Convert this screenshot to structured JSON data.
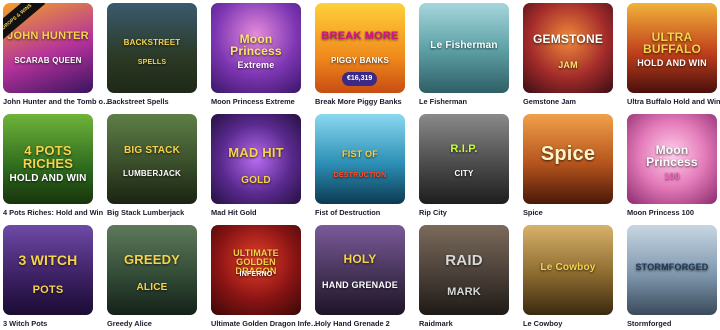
{
  "games": [
    {
      "name": "John Hunter and the Tomb of the Scarab Queen",
      "logo": "JOHN HUNTER",
      "sublogo": "SCARAB QUEEN",
      "badge": "DROPS & WINS",
      "bg": "#6a2f7d"
    },
    {
      "name": "Backstreet Spells",
      "logo": "BACKSTREET",
      "sublogo": "SPELLS",
      "bg": "#2b3a25"
    },
    {
      "name": "Moon Princess Extreme",
      "logo": "Moon Princess",
      "sublogo": "Extreme",
      "bg": "#6b2fa0"
    },
    {
      "name": "Break More Piggy Banks",
      "logo": "BREAK MORE",
      "sublogo": "PIGGY BANKS",
      "jackpot": "€16,319",
      "bg": "#f0c31c"
    },
    {
      "name": "Le Fisherman",
      "logo": "Le Fisherman",
      "bg": "#5fa3a7"
    },
    {
      "name": "Gemstone Jam",
      "logo": "GEMSTONE",
      "sublogo": "JAM",
      "bg": "#7a2323"
    },
    {
      "name": "Ultra Buffalo Hold and Win",
      "logo": "ULTRA BUFFALO",
      "sublogo": "HOLD AND WIN",
      "bg": "#7d1f1a"
    },
    {
      "name": "4 Pots Riches: Hold and Win",
      "logo": "4 POTS RICHES",
      "sublogo": "HOLD AND WIN",
      "bg": "#2e6a1d"
    },
    {
      "name": "Big Stack Lumberjack",
      "logo": "BIG STACK",
      "sublogo": "LUMBERJACK",
      "bg": "#3a4e2b"
    },
    {
      "name": "Mad Hit Gold",
      "logo": "MAD HIT",
      "sublogo": "GOLD",
      "bg": "#5a2a8f"
    },
    {
      "name": "Fist of Destruction",
      "logo": "FIST OF",
      "sublogo": "DESTRUCTION",
      "bg": "#2c8fb5"
    },
    {
      "name": "Rip City",
      "logo": "R.I.P.",
      "sublogo": "CITY",
      "bg": "#4c4c4c"
    },
    {
      "name": "Spice",
      "logo": "Spice",
      "bg": "#b5541d"
    },
    {
      "name": "Moon Princess 100",
      "logo": "Moon Princess",
      "sublogo": "100",
      "bg": "#d964a3"
    },
    {
      "name": "3 Witch Pots",
      "logo": "3 WITCH",
      "sublogo": "POTS",
      "bg": "#4c2a7a"
    },
    {
      "name": "Greedy Alice",
      "logo": "GREEDY",
      "sublogo": "ALICE",
      "bg": "#334c37"
    },
    {
      "name": "Ultimate Golden Dragon Inferno",
      "logo": "ULTIMATE GOLDEN DRAGON",
      "sublogo": "INFERNO",
      "bg": "#8a1414"
    },
    {
      "name": "Holy Hand Grenade 2",
      "logo": "HOLY",
      "sublogo": "HAND GRENADE",
      "bg": "#463458"
    },
    {
      "name": "Raidmark",
      "logo": "RAID",
      "sublogo": "MARK",
      "bg": "#4a4038"
    },
    {
      "name": "Le Cowboy",
      "logo": "Le Cowboy",
      "bg": "#8c6a2f"
    },
    {
      "name": "Stormforged",
      "logo": "STORMFORGED",
      "bg": "#7f97ad"
    }
  ],
  "colors": {
    "logo_gold": "#f7d34a",
    "logo_pink": "#ff5fbf",
    "label_text": "#1b1b2e"
  }
}
